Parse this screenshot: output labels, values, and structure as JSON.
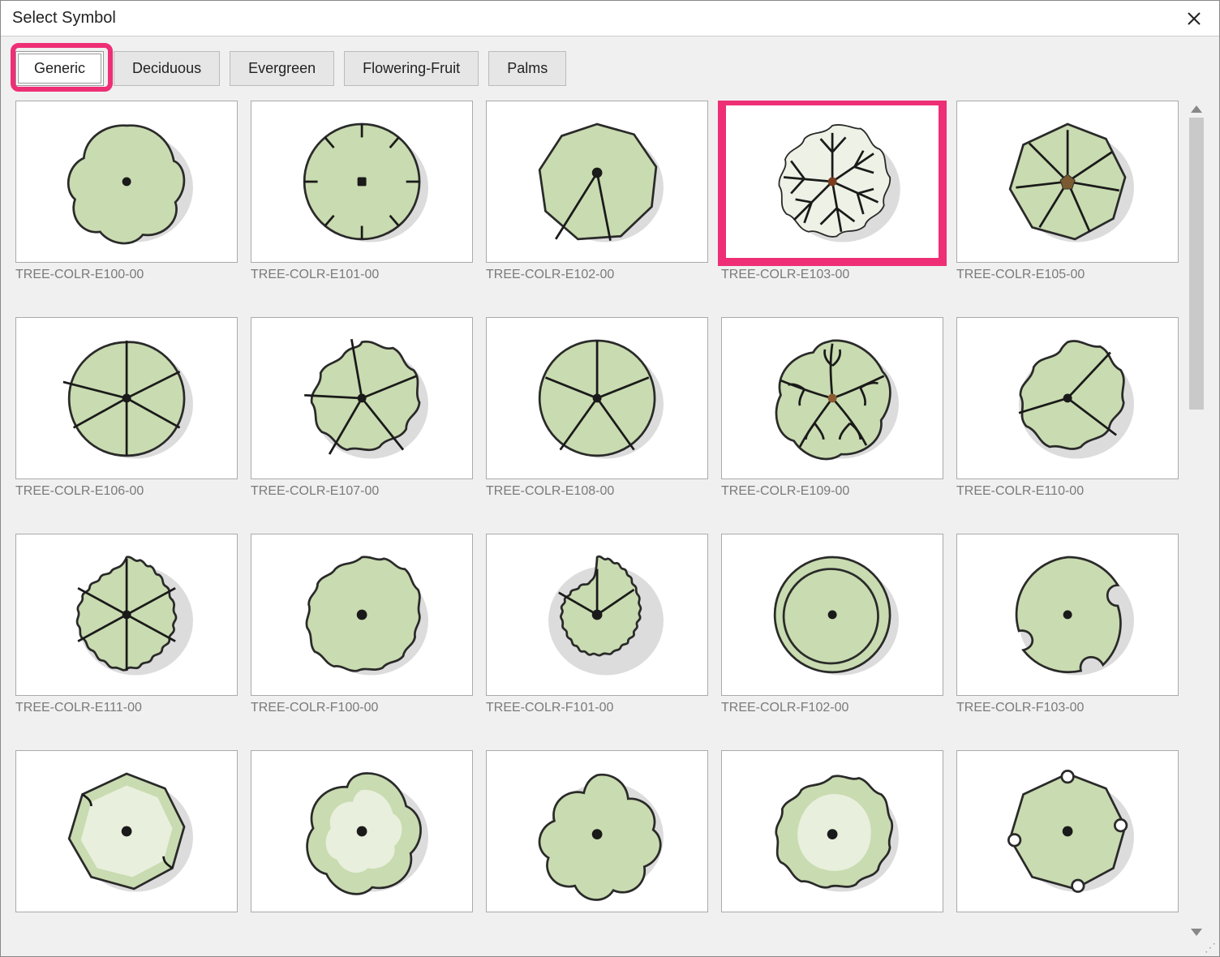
{
  "window": {
    "title": "Select Symbol"
  },
  "tabs": [
    {
      "label": "Generic",
      "active": true,
      "highlight": true
    },
    {
      "label": "Deciduous",
      "active": false
    },
    {
      "label": "Evergreen",
      "active": false
    },
    {
      "label": "Flowering-Fruit",
      "active": false
    },
    {
      "label": "Palms",
      "active": false
    }
  ],
  "highlight_color": "#ee2f75",
  "leaf_color": "#c9dbb0",
  "symbols": [
    {
      "label": "TREE-COLR-E100-00",
      "variant": "lobed6",
      "highlight": false
    },
    {
      "label": "TREE-COLR-E101-00",
      "variant": "notchcircle",
      "highlight": false
    },
    {
      "label": "TREE-COLR-E102-00",
      "variant": "polygon",
      "highlight": false
    },
    {
      "label": "TREE-COLR-E103-00",
      "variant": "branchy",
      "highlight": true
    },
    {
      "label": "TREE-COLR-E105-00",
      "variant": "octstar",
      "highlight": false
    },
    {
      "label": "TREE-COLR-E106-00",
      "variant": "wedges",
      "highlight": false
    },
    {
      "label": "TREE-COLR-E107-00",
      "variant": "wavywedge",
      "highlight": false
    },
    {
      "label": "TREE-COLR-E108-00",
      "variant": "circlewedge",
      "highlight": false
    },
    {
      "label": "TREE-COLR-E109-00",
      "variant": "star5",
      "highlight": false
    },
    {
      "label": "TREE-COLR-E110-00",
      "variant": "wavytri",
      "highlight": false
    },
    {
      "label": "TREE-COLR-E111-00",
      "variant": "frillywedge",
      "highlight": false
    },
    {
      "label": "TREE-COLR-F100-00",
      "variant": "scallop",
      "highlight": false
    },
    {
      "label": "TREE-COLR-F101-00",
      "variant": "frilly",
      "highlight": false
    },
    {
      "label": "TREE-COLR-F102-00",
      "variant": "dblcircle",
      "highlight": false
    },
    {
      "label": "TREE-COLR-F103-00",
      "variant": "notch3",
      "highlight": false
    },
    {
      "label": "",
      "variant": "oct2tone",
      "highlight": false
    },
    {
      "label": "",
      "variant": "lobed5",
      "highlight": false
    },
    {
      "label": "",
      "variant": "flower5",
      "highlight": false
    },
    {
      "label": "",
      "variant": "cloud",
      "highlight": false
    },
    {
      "label": "",
      "variant": "octnotch",
      "highlight": false
    }
  ]
}
